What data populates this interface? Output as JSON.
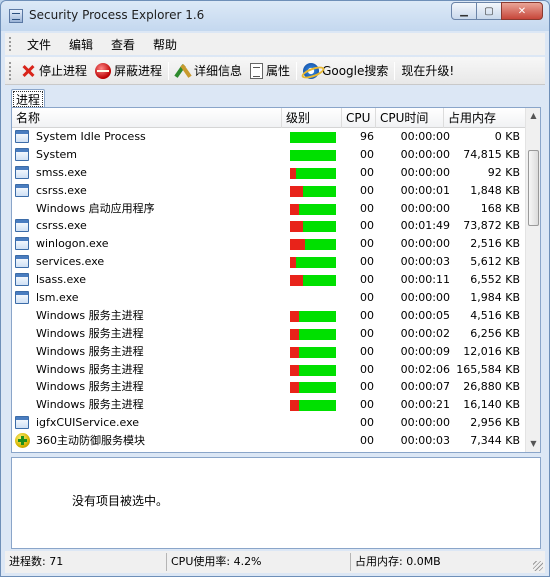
{
  "window": {
    "title": "Security Process Explorer 1.6"
  },
  "menu": [
    "文件",
    "编辑",
    "查看",
    "帮助"
  ],
  "toolbar": {
    "stop_label": "停止进程",
    "hide_label": "屏蔽进程",
    "details_label": "详细信息",
    "props_label": "属性",
    "google_label": "Google搜索",
    "upgrade_label": "现在升级!"
  },
  "tab": {
    "label": "进程"
  },
  "columns": {
    "name": "名称",
    "level": "级别",
    "cpu": "CPU",
    "cpu_time": "CPU时间",
    "memory": "占用内存"
  },
  "processes": [
    {
      "name": "System Idle Process",
      "icon": "window-icon",
      "risk": 0,
      "cpu": "96",
      "cpu_time": "00:00:00",
      "memory": "0 KB"
    },
    {
      "name": "System",
      "icon": "window-icon",
      "risk": 0,
      "cpu": "00",
      "cpu_time": "00:00:00",
      "memory": "74,815 KB"
    },
    {
      "name": "smss.exe",
      "icon": "window-icon",
      "risk": 0.12,
      "cpu": "00",
      "cpu_time": "00:00:00",
      "memory": "92 KB"
    },
    {
      "name": "csrss.exe",
      "icon": "window-icon",
      "risk": 0.28,
      "cpu": "00",
      "cpu_time": "00:00:01",
      "memory": "1,848 KB"
    },
    {
      "name": "Windows 启动应用程序",
      "icon": "",
      "risk": 0.2,
      "cpu": "00",
      "cpu_time": "00:00:00",
      "memory": "168 KB"
    },
    {
      "name": "csrss.exe",
      "icon": "window-icon",
      "risk": 0.28,
      "cpu": "00",
      "cpu_time": "00:01:49",
      "memory": "73,872 KB"
    },
    {
      "name": "winlogon.exe",
      "icon": "window-icon",
      "risk": 0.32,
      "cpu": "00",
      "cpu_time": "00:00:00",
      "memory": "2,516 KB"
    },
    {
      "name": "services.exe",
      "icon": "window-icon",
      "risk": 0.12,
      "cpu": "00",
      "cpu_time": "00:00:03",
      "memory": "5,612 KB"
    },
    {
      "name": "lsass.exe",
      "icon": "window-icon",
      "risk": 0.28,
      "cpu": "00",
      "cpu_time": "00:00:11",
      "memory": "6,552 KB"
    },
    {
      "name": "lsm.exe",
      "icon": "window-icon",
      "risk": null,
      "cpu": "00",
      "cpu_time": "00:00:00",
      "memory": "1,984 KB"
    },
    {
      "name": "Windows 服务主进程",
      "icon": "",
      "risk": 0.2,
      "cpu": "00",
      "cpu_time": "00:00:05",
      "memory": "4,516 KB"
    },
    {
      "name": "Windows 服务主进程",
      "icon": "",
      "risk": 0.2,
      "cpu": "00",
      "cpu_time": "00:00:02",
      "memory": "6,256 KB"
    },
    {
      "name": "Windows 服务主进程",
      "icon": "",
      "risk": 0.2,
      "cpu": "00",
      "cpu_time": "00:00:09",
      "memory": "12,016 KB"
    },
    {
      "name": "Windows 服务主进程",
      "icon": "",
      "risk": 0.2,
      "cpu": "00",
      "cpu_time": "00:02:06",
      "memory": "165,584 KB"
    },
    {
      "name": "Windows 服务主进程",
      "icon": "",
      "risk": 0.2,
      "cpu": "00",
      "cpu_time": "00:00:07",
      "memory": "26,880 KB"
    },
    {
      "name": "Windows 服务主进程",
      "icon": "",
      "risk": 0.2,
      "cpu": "00",
      "cpu_time": "00:00:21",
      "memory": "16,140 KB"
    },
    {
      "name": "igfxCUIService.exe",
      "icon": "window-icon",
      "risk": null,
      "cpu": "00",
      "cpu_time": "00:00:00",
      "memory": "2,956 KB"
    },
    {
      "name": "360主动防御服务模块",
      "icon": "shield-plus-icon",
      "risk": null,
      "cpu": "00",
      "cpu_time": "00:00:03",
      "memory": "7,344 KB"
    }
  ],
  "detail": {
    "empty_text": "没有项目被选中。"
  },
  "status": {
    "process_count": "进程数: 71",
    "cpu_usage": "CPU使用率: 4.2%",
    "memory_usage": "占用内存: 0.0MB"
  },
  "colors": {
    "level_safe": "#00e000",
    "level_risk": "#e8231a"
  }
}
